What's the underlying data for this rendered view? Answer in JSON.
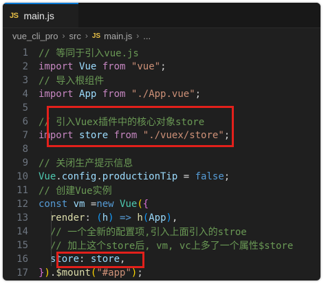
{
  "tab": {
    "icon": "JS",
    "label": "main.js"
  },
  "breadcrumb": {
    "items": [
      "vue_cli_pro",
      "src",
      "main.js",
      "..."
    ],
    "file_icon": "JS"
  },
  "colors": {
    "highlight": "#e3201b",
    "tab_accent": "#0078d4",
    "js_icon": "#e9c046"
  },
  "lines": [
    {
      "n": "1",
      "tokens": [
        [
          "c-comment",
          "// 等同于引入vue.js"
        ]
      ]
    },
    {
      "n": "2",
      "tokens": [
        [
          "c-kw",
          "import"
        ],
        [
          "c-plain",
          " "
        ],
        [
          "c-id",
          "Vue"
        ],
        [
          "c-plain",
          " "
        ],
        [
          "c-kw",
          "from"
        ],
        [
          "c-plain",
          " "
        ],
        [
          "c-str",
          "\"vue\""
        ],
        [
          "c-plain",
          ";"
        ]
      ]
    },
    {
      "n": "3",
      "tokens": [
        [
          "c-comment",
          "// 导入根组件"
        ]
      ]
    },
    {
      "n": "4",
      "tokens": [
        [
          "c-kw",
          "import"
        ],
        [
          "c-plain",
          " "
        ],
        [
          "c-id",
          "App"
        ],
        [
          "c-plain",
          " "
        ],
        [
          "c-kw",
          "from"
        ],
        [
          "c-plain",
          " "
        ],
        [
          "c-str",
          "\"./App.vue\""
        ],
        [
          "c-plain",
          ";"
        ]
      ]
    },
    {
      "n": "5",
      "tokens": []
    },
    {
      "n": "6",
      "tokens": [
        [
          "c-comment",
          "// 引入Vuex插件中的核心对象store"
        ]
      ]
    },
    {
      "n": "7",
      "tokens": [
        [
          "c-kw",
          "import"
        ],
        [
          "c-plain",
          " "
        ],
        [
          "c-id",
          "store"
        ],
        [
          "c-plain",
          " "
        ],
        [
          "c-kw",
          "from"
        ],
        [
          "c-plain",
          " "
        ],
        [
          "c-str",
          "\"./vuex/store\""
        ],
        [
          "c-plain",
          ";"
        ]
      ]
    },
    {
      "n": "8",
      "tokens": []
    },
    {
      "n": "9",
      "tokens": [
        [
          "c-comment",
          "// 关闭生产提示信息"
        ]
      ]
    },
    {
      "n": "10",
      "tokens": [
        [
          "c-cls",
          "Vue"
        ],
        [
          "c-plain",
          "."
        ],
        [
          "c-id",
          "config"
        ],
        [
          "c-plain",
          "."
        ],
        [
          "c-id",
          "productionTip"
        ],
        [
          "c-plain",
          " = "
        ],
        [
          "c-bool",
          "false"
        ],
        [
          "c-plain",
          ";"
        ]
      ]
    },
    {
      "n": "11",
      "tokens": [
        [
          "c-comment",
          "// 创建Vue实例"
        ]
      ]
    },
    {
      "n": "12",
      "tokens": [
        [
          "c-const",
          "const"
        ],
        [
          "c-plain",
          " "
        ],
        [
          "c-id",
          "vm"
        ],
        [
          "c-plain",
          " ="
        ],
        [
          "c-const",
          "new"
        ],
        [
          "c-plain",
          " "
        ],
        [
          "c-cls",
          "Vue"
        ],
        [
          "c-brace1",
          "("
        ],
        [
          "c-brace2",
          "{"
        ]
      ]
    },
    {
      "n": "13",
      "indent": true,
      "tokens": [
        [
          "c-plain",
          "  "
        ],
        [
          "c-func",
          "render"
        ],
        [
          "c-plain",
          ": "
        ],
        [
          "c-brace3",
          "("
        ],
        [
          "c-id",
          "h"
        ],
        [
          "c-brace3",
          ")"
        ],
        [
          "c-plain",
          " "
        ],
        [
          "c-const",
          "=>"
        ],
        [
          "c-plain",
          " "
        ],
        [
          "c-func",
          "h"
        ],
        [
          "c-brace3",
          "("
        ],
        [
          "c-id",
          "App"
        ],
        [
          "c-brace3",
          ")"
        ],
        [
          "c-plain",
          ","
        ]
      ]
    },
    {
      "n": "14",
      "indent": true,
      "tokens": [
        [
          "c-plain",
          "  "
        ],
        [
          "c-comment",
          "// 一个全新的配置项,引入上面引入的stroe"
        ]
      ]
    },
    {
      "n": "15",
      "indent": true,
      "tokens": [
        [
          "c-plain",
          "  "
        ],
        [
          "c-comment",
          "// 加上这个store后, vm, vc上多了一个属性$store"
        ]
      ]
    },
    {
      "n": "16",
      "indent": true,
      "tokens": [
        [
          "c-plain",
          "  "
        ],
        [
          "c-id",
          "store"
        ],
        [
          "c-plain",
          ": "
        ],
        [
          "c-id",
          "store"
        ],
        [
          "c-plain",
          ","
        ]
      ]
    },
    {
      "n": "17",
      "tokens": [
        [
          "c-brace2",
          "}"
        ],
        [
          "c-brace1",
          ")"
        ],
        [
          "c-plain",
          "."
        ],
        [
          "c-func",
          "$mount"
        ],
        [
          "c-brace1",
          "("
        ],
        [
          "c-str",
          "\"#app\""
        ],
        [
          "c-brace1",
          ")"
        ],
        [
          "c-plain",
          ";"
        ]
      ]
    }
  ]
}
